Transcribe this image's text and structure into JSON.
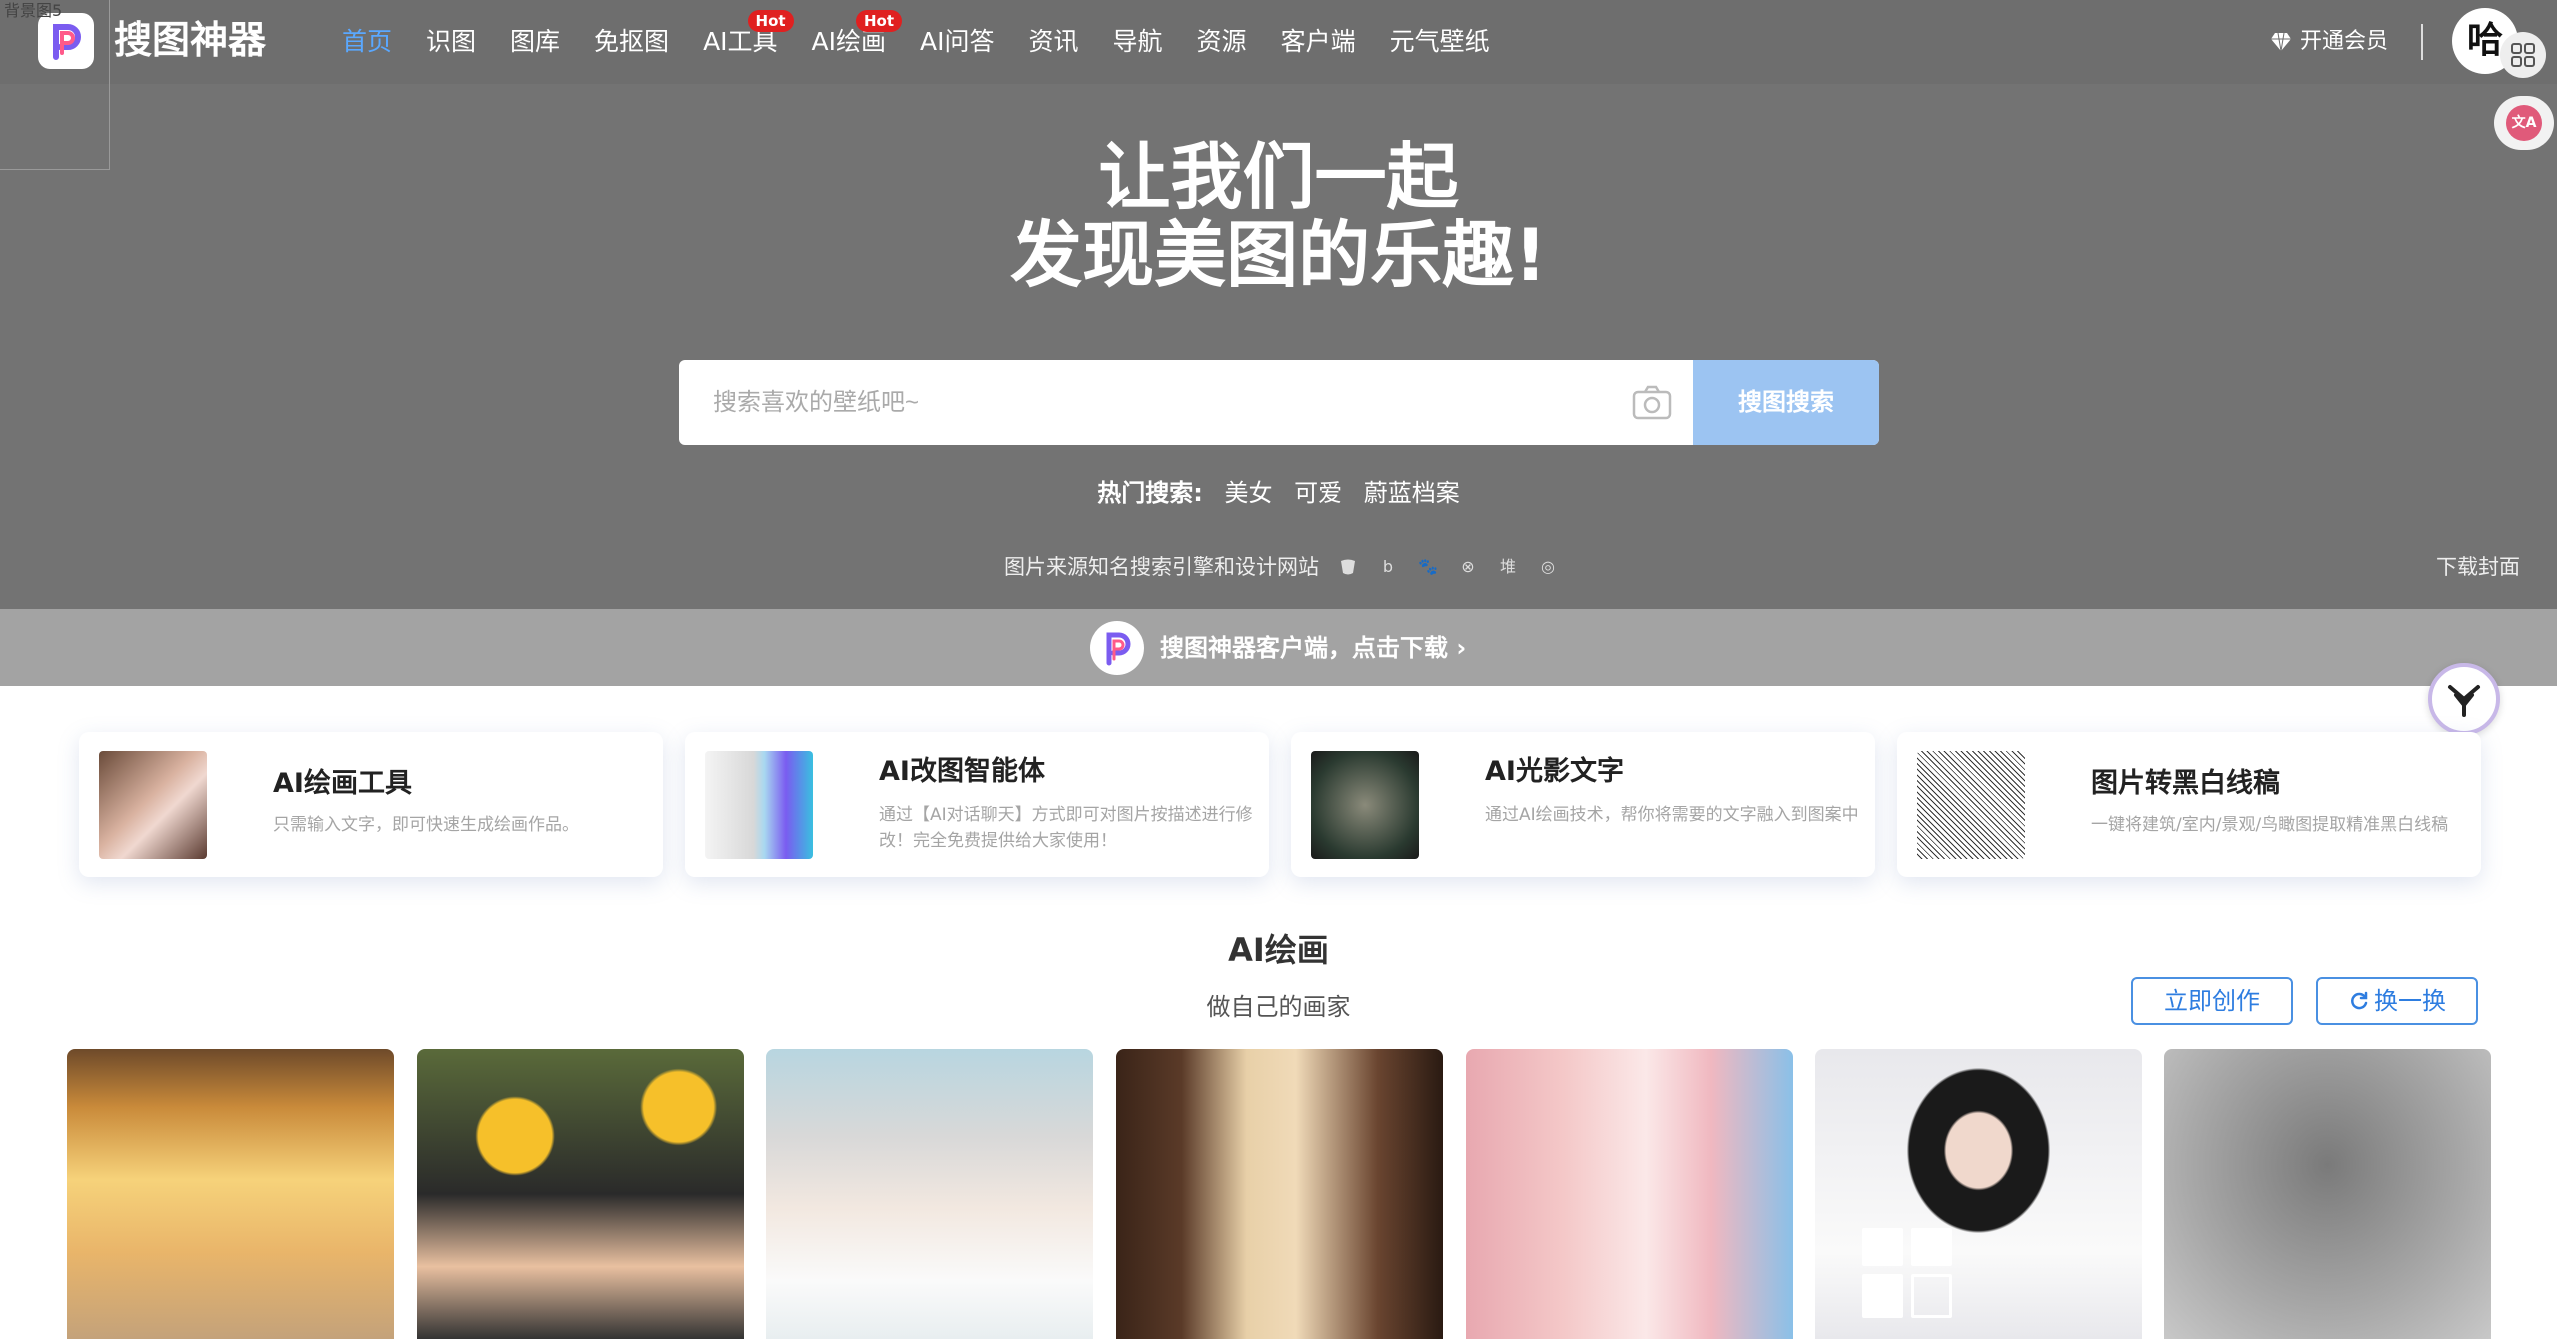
{
  "hero": {
    "bg_alt": "背景图5",
    "brand": "搜图神器",
    "nav": [
      {
        "label": "首页",
        "active": true
      },
      {
        "label": "识图"
      },
      {
        "label": "图库"
      },
      {
        "label": "免抠图"
      },
      {
        "label": "AI工具",
        "badge": "Hot"
      },
      {
        "label": "AI绘画",
        "badge": "Hot"
      },
      {
        "label": "AI问答"
      },
      {
        "label": "资讯"
      },
      {
        "label": "导航"
      },
      {
        "label": "资源"
      },
      {
        "label": "客户端"
      },
      {
        "label": "元气壁纸"
      }
    ],
    "vip_label": "开通会员",
    "avatar_text": "哈",
    "translate_label": "文A",
    "slogan_line1": "让我们一起",
    "slogan_line2": "发现美图的乐趣!",
    "search_placeholder": "搜索喜欢的壁纸吧~",
    "search_button": "搜图搜索",
    "hot_label": "热门搜索:",
    "hot_items": [
      "美女",
      "可爱",
      "蔚蓝档案"
    ],
    "source_text": "图片来源知名搜索引擎和设计网站",
    "source_icons": [
      "b",
      "🐾",
      "⊗",
      "堆",
      "◎"
    ],
    "download_cover": "下载封面",
    "client_text": "搜图神器客户端，点击下载 ›"
  },
  "tools": [
    {
      "title": "AI绘画工具",
      "desc": "只需输入文字，即可快速生成绘画作品。"
    },
    {
      "title": "AI改图智能体",
      "desc": "通过【AI对话聊天】方式即可对图片按描述进行修改！完全免费提供给大家使用！"
    },
    {
      "title": "AI光影文字",
      "desc": "通过AI绘画技术，帮你将需要的文字融入到图案中"
    },
    {
      "title": "图片转黑白线稿",
      "desc": "一键将建筑/室内/景观/鸟瞰图提取精准黑白线稿"
    }
  ],
  "section": {
    "title": "AI绘画",
    "subtitle": "做自己的画家",
    "create_button": "立即创作",
    "refresh_button": "换一换"
  },
  "colors": {
    "accent": "#4a90e2",
    "hot_badge": "#e02020",
    "hero_bg": "#737373"
  }
}
